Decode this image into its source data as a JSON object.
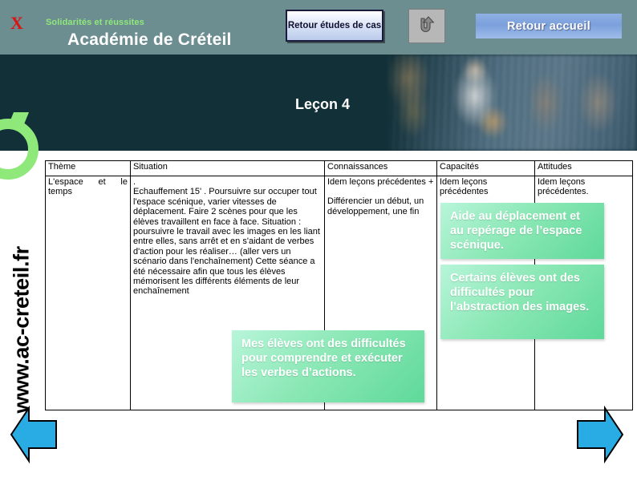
{
  "header": {
    "broken_image_glyph": "X",
    "tagline": "Solidarités et réussites",
    "title": "Académie de Créteil",
    "buttons": {
      "retour_etudes": "Retour études de cas",
      "uturn_icon": "u-turn-arrow-icon",
      "retour_accueil": "Retour accueil"
    }
  },
  "banner": {
    "lesson_title": "Leçon 4"
  },
  "sidebar": {
    "url": "www.ac-creteil.fr",
    "logo_icon": "academie-creteil-logo-icon"
  },
  "navigation": {
    "prev_label": "previous-slide-arrow",
    "next_label": "next-slide-arrow"
  },
  "table": {
    "headers": [
      "Thème",
      "Situation",
      "Connaissances",
      "Capacités",
      "Attitudes"
    ],
    "row": {
      "theme": "L'espace et le temps",
      "situation_lead": ".",
      "situation": "Echauffement 15' . Poursuivre sur occuper tout l'espace scénique, varier vitesses de déplacement. Faire 2 scènes pour que les élèves travaillent en face à face. Situation : poursuivre le travail avec les images en les liant entre elles, sans arrêt et en s'aidant de verbes d'action pour les réaliser… (aller vers un scénario dans l'enchaînement) Cette séance a été nécessaire afin que tous les élèves mémorisent les différents éléments de leur enchaînement",
      "connaissances_1": "Idem leçons précédentes +",
      "connaissances_2": "Différencier un début, un développement, une fin",
      "capacites": "Idem leçons précédentes",
      "attitudes": "Idem leçons précédentes."
    }
  },
  "callouts": {
    "aide": "Aide au déplacement et au repérage de l’espace scénique.",
    "certains": "Certains élèves ont des difficultés pour l’abstraction des images.",
    "mes_eleves": "Mes élèves ont des difficultés pour comprendre et exécuter les verbes d’actions."
  },
  "colors": {
    "header_band": "#6d8e91",
    "banner_dark": "#123038",
    "logo_green": "#8ee87a",
    "callout_green": "#5fd99a",
    "accueil_blue": "#7ba0dc",
    "arrow_blue": "#29ace3",
    "broken_image_red": "#d81515"
  }
}
